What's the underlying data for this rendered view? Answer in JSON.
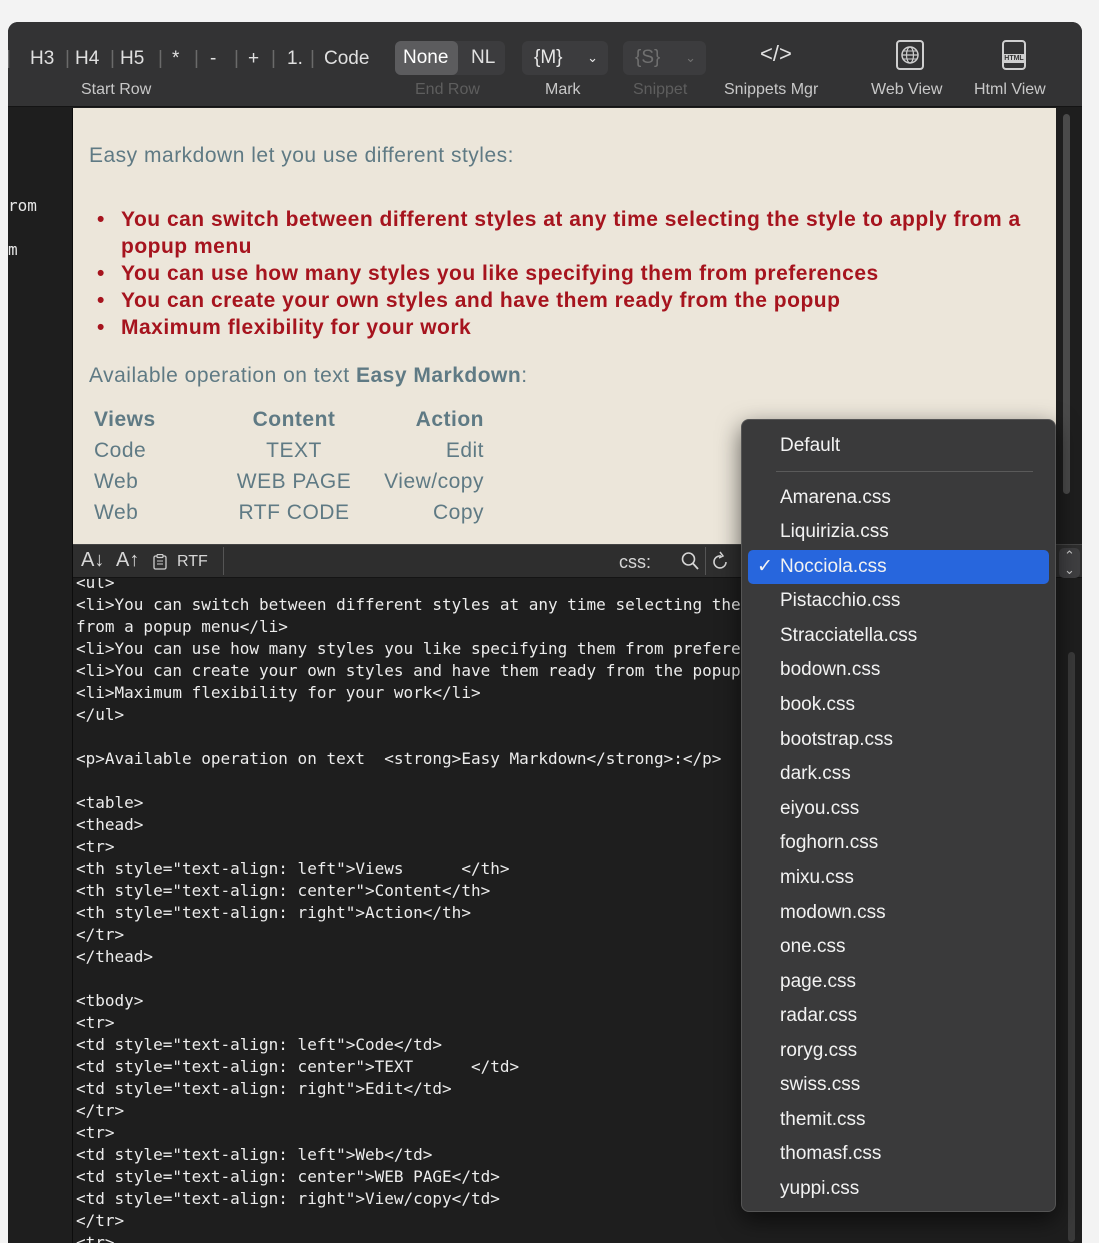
{
  "toolbar": {
    "heading_buttons": [
      "H3",
      "H4",
      "H5"
    ],
    "list_buttons": [
      "*",
      "-",
      "+",
      "1."
    ],
    "code_label": "Code",
    "none_label": "None",
    "nl_label": "NL",
    "start_row_label": "Start Row",
    "end_row_label": "End Row",
    "mark_value": "{M}",
    "mark_label": "Mark",
    "snippet_value": "{S}",
    "snippet_label": "Snippet",
    "snippets_mgr_icon": "</>",
    "snippets_mgr_label": "Snippets Mgr",
    "web_view_label": "Web View",
    "html_view_label": "Html View",
    "html_icon_text": "HTML"
  },
  "left_pane": {
    "line1": "rom",
    "line2": "m"
  },
  "preview": {
    "intro": "Easy markdown let you use different styles:",
    "bullets": [
      "You can switch between different styles at any time selecting the style to apply from a popup menu",
      "You can use how many styles you like specifying them from preferences",
      "You can create your own styles and have them ready from the popup",
      "Maximum flexibility for your work"
    ],
    "available_prefix": "Available operation on text ",
    "available_strong": "Easy Markdown",
    "available_suffix": ":",
    "table_headers": [
      "Views",
      "Content",
      "Action"
    ],
    "table_rows": [
      [
        "Code",
        "TEXT",
        "Edit"
      ],
      [
        "Web",
        "WEB PAGE",
        "View/copy"
      ],
      [
        "Web",
        "RTF CODE",
        "Copy"
      ]
    ]
  },
  "bottom_bar": {
    "sort_down_label": "A↓",
    "sort_up_label": "A↑",
    "rtf_label": "RTF",
    "css_label": "css:"
  },
  "code_text": "<ul>\n<li>You can switch between different styles at any time selecting the style to apply\nfrom a popup menu</li>\n<li>You can use how many styles you like specifying them from preferences</li>\n<li>You can create your own styles and have them ready from the popup</li>\n<li>Maximum flexibility for your work</li>\n</ul>\n\n<p>Available operation on text  <strong>Easy Markdown</strong>:</p>\n\n<table>\n<thead>\n<tr>\n<th style=\"text-align: left\">Views      </th>\n<th style=\"text-align: center\">Content</th>\n<th style=\"text-align: right\">Action</th>\n</tr>\n</thead>\n\n<tbody>\n<tr>\n<td style=\"text-align: left\">Code</td>\n<td style=\"text-align: center\">TEXT      </td>\n<td style=\"text-align: right\">Edit</td>\n</tr>\n<tr>\n<td style=\"text-align: left\">Web</td>\n<td style=\"text-align: center\">WEB PAGE</td>\n<td style=\"text-align: right\">View/copy</td>\n</tr>\n<tr>",
  "css_menu": {
    "default_label": "Default",
    "items": [
      "Amarena.css",
      "Liquirizia.css",
      "Nocciola.css",
      "Pistacchio.css",
      "Stracciatella.css",
      "bodown.css",
      "book.css",
      "bootstrap.css",
      "dark.css",
      "eiyou.css",
      "foghorn.css",
      "mixu.css",
      "modown.css",
      "one.css",
      "page.css",
      "radar.css",
      "roryg.css",
      "swiss.css",
      "themit.css",
      "thomasf.css",
      "yuppi.css"
    ],
    "selected": "Nocciola.css",
    "checkmark": "✓"
  },
  "colors": {
    "accent_blue": "#2766dd",
    "bullet_red": "#a6141e",
    "preview_bg": "#ece6da",
    "preview_text": "#5f7a84"
  }
}
